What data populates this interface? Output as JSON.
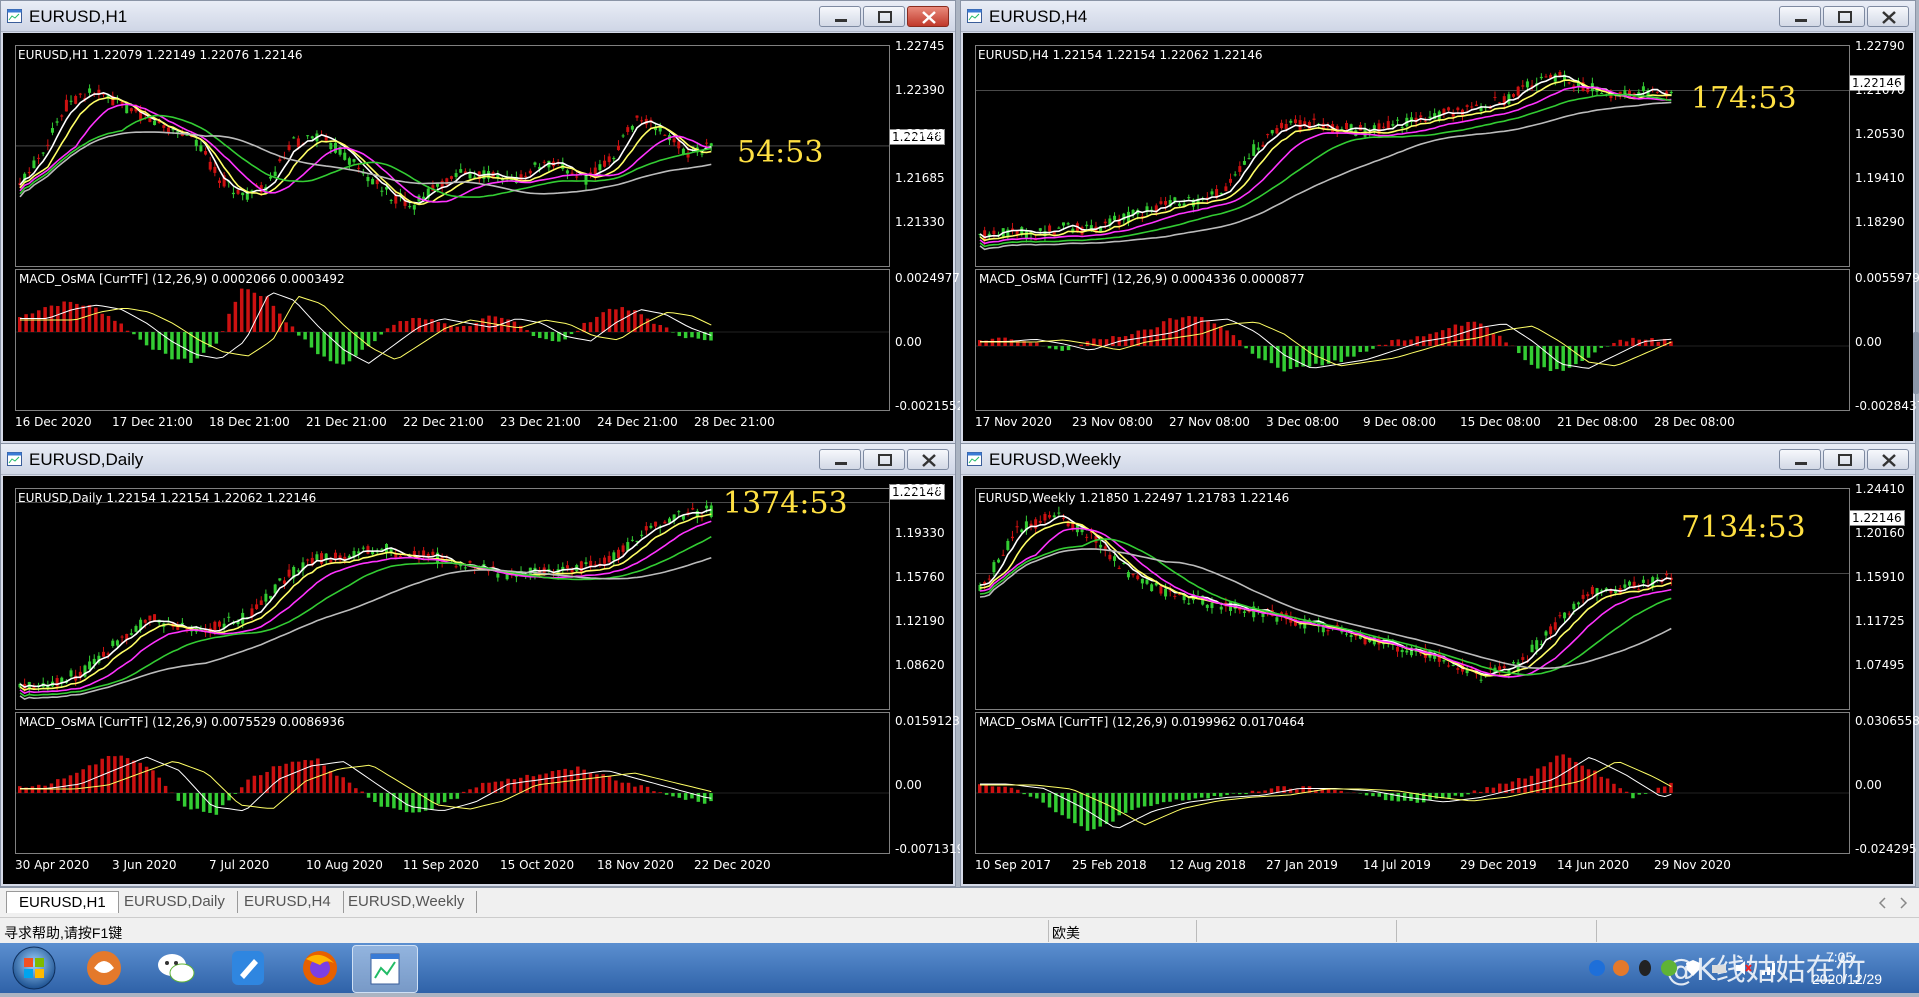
{
  "windows": [
    {
      "id": "h1",
      "title": "EURUSD,H1",
      "ohlc": "EURUSD,H1  1.22079 1.22149 1.22076 1.22146",
      "timer": "54:53",
      "price_tag": "1.22146",
      "price_axis": [
        "1.22745",
        "1.22390",
        "1.22040",
        "1.21685",
        "1.21330"
      ],
      "macd_label": "MACD_OsMA [CurrTF] (12,26,9) 0.0002066 0.0003492",
      "macd_axis": [
        "0.0024977",
        "0.00",
        "-0.0021552"
      ],
      "time_axis": [
        "16 Dec 2020",
        "17 Dec 21:00",
        "18 Dec 21:00",
        "21 Dec 21:00",
        "22 Dec 21:00",
        "23 Dec 21:00",
        "24 Dec 21:00",
        "28 Dec 21:00"
      ]
    },
    {
      "id": "h4",
      "title": "EURUSD,H4",
      "ohlc": "EURUSD,H4  1.22154 1.22154 1.22062 1.22146",
      "timer": "174:53",
      "price_tag": "1.22146",
      "price_axis": [
        "1.22790",
        "1.21670",
        "1.20530",
        "1.19410",
        "1.18290"
      ],
      "macd_label": "MACD_OsMA [CurrTF] (12,26,9) 0.0004336 0.0000877",
      "macd_axis": [
        "0.0055979",
        "0.00",
        "-0.0028437"
      ],
      "time_axis": [
        "17 Nov 2020",
        "23 Nov 08:00",
        "27 Nov 08:00",
        "3 Dec 08:00",
        "9 Dec 08:00",
        "15 Dec 08:00",
        "21 Dec 08:00",
        "28 Dec 08:00"
      ]
    },
    {
      "id": "daily",
      "title": "EURUSD,Daily",
      "ohlc": "EURUSD,Daily  1.22154 1.22154 1.22062 1.22146",
      "timer": "1374:53",
      "price_tag": "1.22146",
      "price_axis": [
        "1.22900",
        "1.19330",
        "1.15760",
        "1.12190",
        "1.08620"
      ],
      "macd_label": "MACD_OsMA [CurrTF] (12,26,9) 0.0075529 0.0086936",
      "macd_axis": [
        "0.0159123",
        "0.00",
        "-0.0071319"
      ],
      "time_axis": [
        "30 Apr 2020",
        "3 Jun 2020",
        "7 Jul 2020",
        "10 Aug 2020",
        "11 Sep 2020",
        "15 Oct 2020",
        "18 Nov 2020",
        "22 Dec 2020"
      ]
    },
    {
      "id": "weekly",
      "title": "EURUSD,Weekly",
      "ohlc": "EURUSD,Weekly  1.21850 1.22497 1.21783 1.22146",
      "timer": "7134:53",
      "price_tag": "1.22146",
      "price_axis": [
        "1.24410",
        "1.20160",
        "1.15910",
        "1.11725",
        "1.07495"
      ],
      "macd_label": "MACD_OsMA [CurrTF] (12,26,9) 0.0199962 0.0170464",
      "macd_axis": [
        "0.0306558",
        "0.00",
        "-0.024295"
      ],
      "time_axis": [
        "10 Sep 2017",
        "25 Feb 2018",
        "12 Aug 2018",
        "27 Jan 2019",
        "14 Jul 2019",
        "29 Dec 2019",
        "14 Jun 2020",
        "29 Nov 2020"
      ]
    }
  ],
  "tabs": [
    "EURUSD,H1",
    "EURUSD,Daily",
    "EURUSD,H4",
    "EURUSD,Weekly"
  ],
  "status": {
    "help": "寻求帮助,请按F1键",
    "profile": "欧美"
  },
  "watermark": "@K线姑姑在竹",
  "clock": {
    "time": "7:05",
    "date": "2020/12/29"
  },
  "colors": {
    "ma1": "#ffffff",
    "ma2": "#ffff66",
    "ma3": "#ff33ff",
    "ma4": "#33cc33",
    "ma5": "#bbbbbb",
    "bull": "#33cc33",
    "bear": "#cc1111",
    "timer": "#ffe042"
  }
}
